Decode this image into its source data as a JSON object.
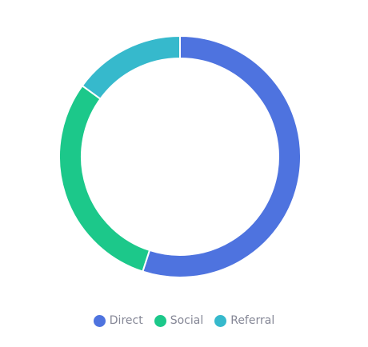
{
  "chart_data": {
    "type": "pie",
    "donut": true,
    "categories": [
      "Direct",
      "Social",
      "Referral"
    ],
    "values": [
      55,
      30,
      15
    ],
    "colors": [
      "#4e73df",
      "#1cc88a",
      "#36b9cc"
    ],
    "legend_position": "bottom"
  },
  "legend": {
    "items": [
      {
        "label": "Direct",
        "color": "#4e73df"
      },
      {
        "label": "Social",
        "color": "#1cc88a"
      },
      {
        "label": "Referral",
        "color": "#36b9cc"
      }
    ]
  }
}
